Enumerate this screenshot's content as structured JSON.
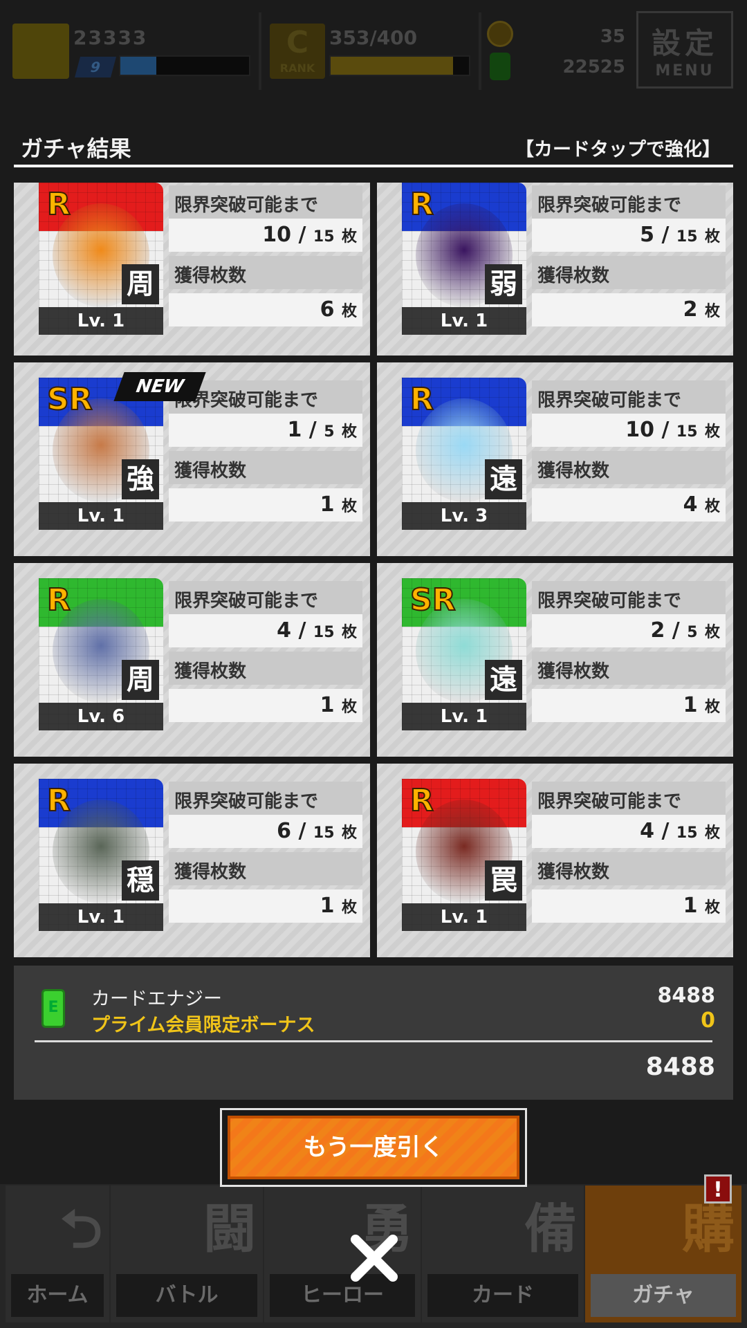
{
  "status": {
    "player_score": "23333",
    "player_level": "9",
    "player_exp_fraction": 0.28,
    "rank_label": "RANK",
    "rank_letter": "C",
    "rank_points": "353/400",
    "rank_fraction": 0.8825,
    "premium_coins": "35",
    "energy": "22525",
    "menu_big": "設定",
    "menu_small": "MENU"
  },
  "result": {
    "title": "ガチャ結果",
    "hint": "【カードタップで強化】"
  },
  "cards": [
    {
      "rarity": "R",
      "type": "周",
      "level": "Lv. 1",
      "limit_label": "限界突破可能まで",
      "limit_cur": "10",
      "limit_max": "15",
      "unit": "枚",
      "count_label": "獲得枚数",
      "count": "6",
      "is_new": false,
      "band_color": "#e31c1c",
      "art_color": "#f08a1a"
    },
    {
      "rarity": "R",
      "type": "弱",
      "level": "Lv. 1",
      "limit_label": "限界突破可能まで",
      "limit_cur": "5",
      "limit_max": "15",
      "unit": "枚",
      "count_label": "獲得枚数",
      "count": "2",
      "is_new": false,
      "band_color": "#1a3ccf",
      "art_color": "#3a1560"
    },
    {
      "rarity": "SR",
      "type": "強",
      "level": "Lv. 1",
      "limit_label": "限界突破可能まで",
      "limit_cur": "1",
      "limit_max": "5",
      "unit": "枚",
      "count_label": "獲得枚数",
      "count": "1",
      "is_new": true,
      "new_label": "NEW",
      "band_color": "#1a3ccf",
      "art_color": "#c77a48"
    },
    {
      "rarity": "R",
      "type": "遠",
      "level": "Lv. 3",
      "limit_label": "限界突破可能まで",
      "limit_cur": "10",
      "limit_max": "15",
      "unit": "枚",
      "count_label": "獲得枚数",
      "count": "4",
      "is_new": false,
      "band_color": "#1a3ccf",
      "art_color": "#9ad9f5"
    },
    {
      "rarity": "R",
      "type": "周",
      "level": "Lv. 6",
      "limit_label": "限界突破可能まで",
      "limit_cur": "4",
      "limit_max": "15",
      "unit": "枚",
      "count_label": "獲得枚数",
      "count": "1",
      "is_new": false,
      "band_color": "#2fb82f",
      "art_color": "#6070a8"
    },
    {
      "rarity": "SR",
      "type": "遠",
      "level": "Lv. 1",
      "limit_label": "限界突破可能まで",
      "limit_cur": "2",
      "limit_max": "5",
      "unit": "枚",
      "count_label": "獲得枚数",
      "count": "1",
      "is_new": false,
      "band_color": "#2fb82f",
      "art_color": "#8fdcd6"
    },
    {
      "rarity": "R",
      "type": "穏",
      "level": "Lv. 1",
      "limit_label": "限界突破可能まで",
      "limit_cur": "6",
      "limit_max": "15",
      "unit": "枚",
      "count_label": "獲得枚数",
      "count": "1",
      "is_new": false,
      "band_color": "#1a3ccf",
      "art_color": "#5a6658"
    },
    {
      "rarity": "R",
      "type": "罠",
      "level": "Lv. 1",
      "limit_label": "限界突破可能まで",
      "limit_cur": "4",
      "limit_max": "15",
      "unit": "枚",
      "count_label": "獲得枚数",
      "count": "1",
      "is_new": false,
      "band_color": "#e31c1c",
      "art_color": "#7a2a22"
    }
  ],
  "energy_panel": {
    "label": "カードエナジー",
    "bonus_label": "プライム会員限定ボーナス",
    "value": "8488",
    "bonus_value": "0",
    "total": "8488"
  },
  "again_button": "もう一度引く",
  "nav": [
    {
      "label": "ホーム",
      "glyph": "⮌"
    },
    {
      "label": "バトル",
      "glyph": "闘"
    },
    {
      "label": "ヒーロー",
      "glyph": "勇"
    },
    {
      "label": "カード",
      "glyph": "備"
    },
    {
      "label": "ガチャ",
      "glyph": "購"
    }
  ],
  "alert_badge": "!",
  "colors": {
    "accent_orange": "#f4781a",
    "gold": "#f0c419",
    "energy_green": "#3bd02f"
  }
}
